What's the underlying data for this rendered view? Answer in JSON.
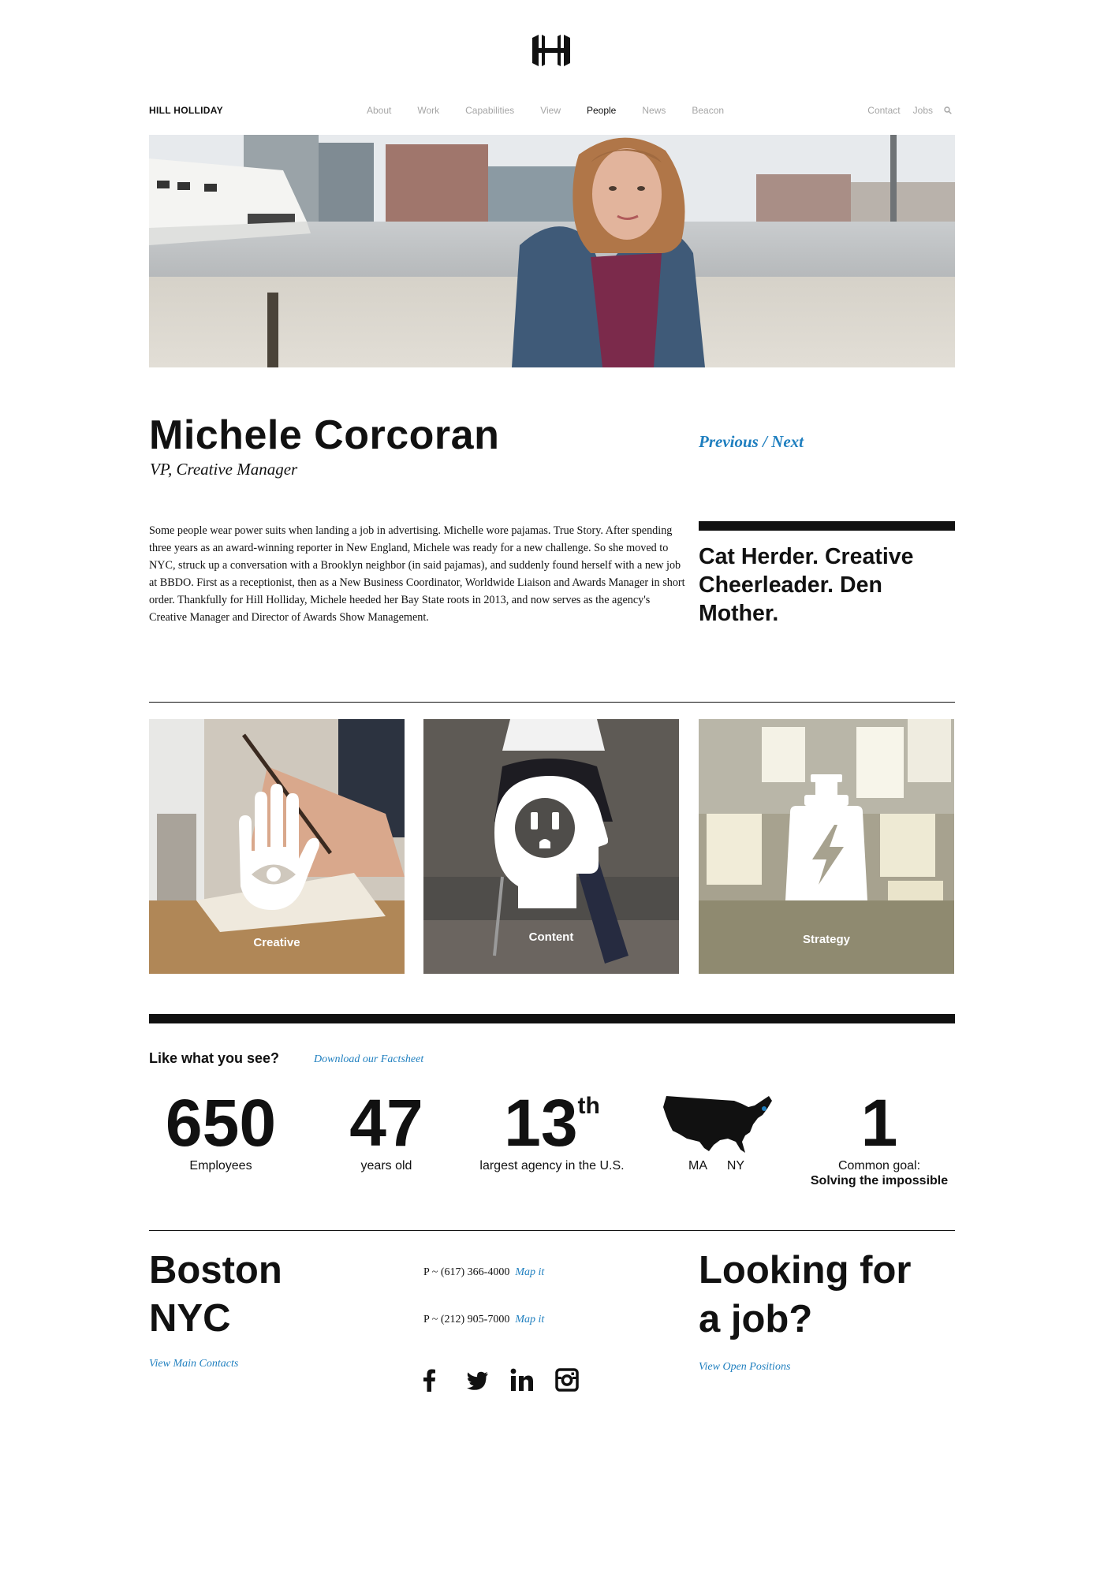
{
  "nav": {
    "brand": "HILL HOLLIDAY",
    "items": [
      {
        "label": "About"
      },
      {
        "label": "Work"
      },
      {
        "label": "Capabilities"
      },
      {
        "label": "View"
      },
      {
        "label": "People"
      },
      {
        "label": "News"
      },
      {
        "label": "Beacon"
      }
    ],
    "active": "People",
    "right": [
      {
        "label": "Contact"
      },
      {
        "label": "Jobs"
      }
    ],
    "search_icon": "search-icon"
  },
  "person": {
    "name": "Michele Corcoran",
    "title": "VP, Creative Manager",
    "previous_label": "Previous",
    "separator": " / ",
    "next_label": "Next",
    "bio": "Some people wear power suits when landing a job in advertising. Michelle wore pajamas. True Story. After spending three years as an award-winning reporter in New England, Michele was ready for a new challenge. So she moved to NYC, struck up a conversation with a Brooklyn neighbor (in said pajamas), and suddenly found herself with a new job at BBDO. First as a receptionist, then as a New Business Coordinator, Worldwide Liaison and Awards Manager in short order. Thankfully for Hill Holliday, Michele heeded her Bay State roots in 2013, and now serves as the agency's Creative Manager and Director of Awards Show Management.",
    "quote": "Cat Herder. Creative Cheerleader. Den Mother."
  },
  "capabilities": [
    {
      "label": "Creative",
      "icon": "hand-eye-icon"
    },
    {
      "label": "Content",
      "icon": "head-outlet-icon"
    },
    {
      "label": "Strategy",
      "icon": "bottle-lightning-icon"
    }
  ],
  "stats": {
    "heading": "Like what you see?",
    "factsheet_link": "Download our Factsheet",
    "employees": {
      "value": "650",
      "label": "Employees"
    },
    "years": {
      "value": "47",
      "label": "years old"
    },
    "rank": {
      "value": "13",
      "suffix": "th",
      "label": "largest agency in the U.S."
    },
    "map": {
      "icon": "usa-map-icon",
      "label_ma": "MA",
      "label_ny": "NY"
    },
    "goal": {
      "value": "1",
      "label": "Common goal:",
      "sublabel": "Solving the impossible"
    }
  },
  "footer": {
    "city_boston": "Boston",
    "city_nyc": "NYC",
    "main_contacts_link": "View Main Contacts",
    "phone_boston": "P ~ (617) 366-4000",
    "phone_nyc": "P ~ (212) 905-7000",
    "map_link": "Map it",
    "social": [
      "facebook-icon",
      "twitter-icon",
      "linkedin-icon",
      "instagram-icon"
    ],
    "jobs_line1": "Looking for",
    "jobs_line2": "a job?",
    "jobs_link": "View Open Positions"
  },
  "colors": {
    "accent": "#1f7fbf",
    "text": "#111111",
    "muted": "#a5a5a5"
  }
}
